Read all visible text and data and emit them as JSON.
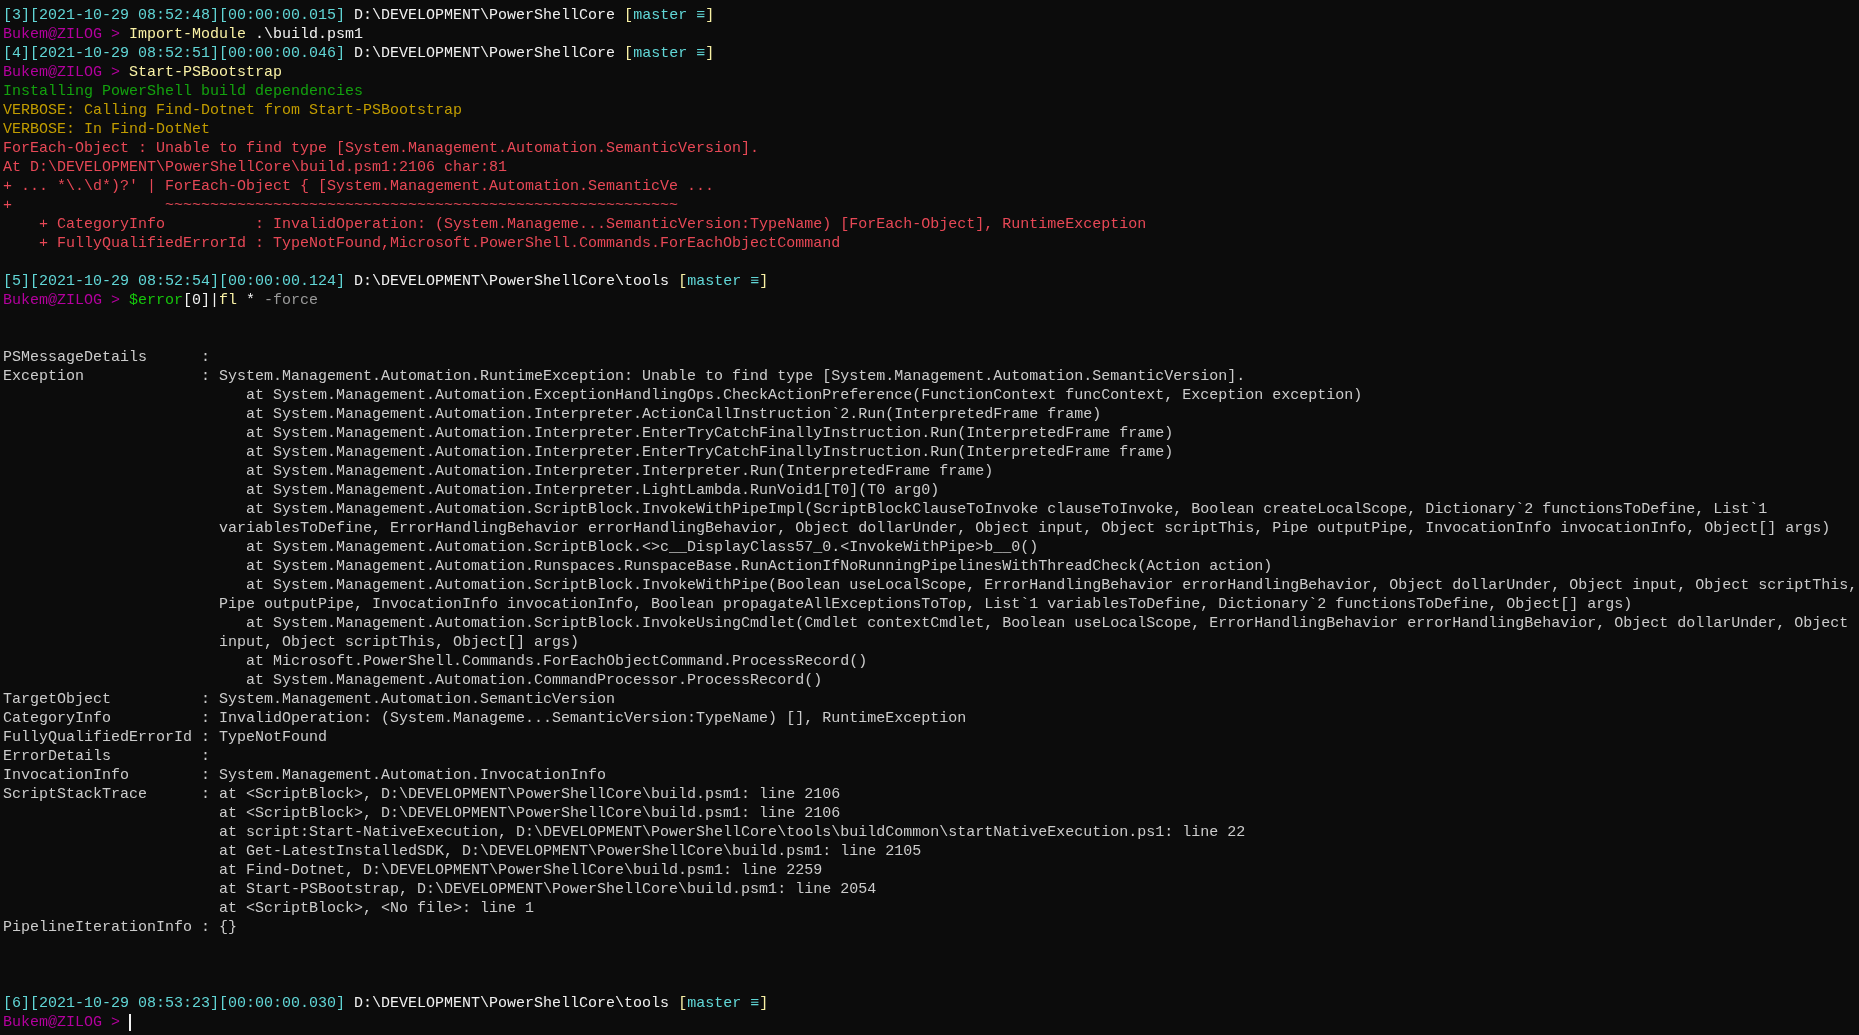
{
  "terminal": {
    "lines": [
      {
        "kind": "text",
        "segments": [
          {
            "kind": "history",
            "text": "[3][2021-10-29 08:52:48][00:00:00.015]"
          },
          {
            "kind": "path",
            "text": " D:\\DEVELOPMENT\\PowerShellCore "
          },
          {
            "kind": "bracket",
            "text": "["
          },
          {
            "kind": "branch",
            "text": "master ≡"
          },
          {
            "kind": "bracket",
            "text": "]"
          }
        ]
      },
      {
        "kind": "text",
        "segments": [
          {
            "kind": "user",
            "text": "Bukem@ZILOG > "
          },
          {
            "kind": "command",
            "text": "Import-Module"
          },
          {
            "kind": "argument",
            "text": " .\\build.psm1"
          }
        ]
      },
      {
        "kind": "text",
        "segments": [
          {
            "kind": "history",
            "text": "[4][2021-10-29 08:52:51][00:00:00.046]"
          },
          {
            "kind": "path",
            "text": " D:\\DEVELOPMENT\\PowerShellCore "
          },
          {
            "kind": "bracket",
            "text": "["
          },
          {
            "kind": "branch",
            "text": "master ≡"
          },
          {
            "kind": "bracket",
            "text": "]"
          }
        ]
      },
      {
        "kind": "text",
        "segments": [
          {
            "kind": "user",
            "text": "Bukem@ZILOG > "
          },
          {
            "kind": "command",
            "text": "Start-PSBootstrap"
          }
        ]
      },
      {
        "kind": "text",
        "segments": [
          {
            "kind": "success",
            "text": "Installing PowerShell build dependencies"
          }
        ]
      },
      {
        "kind": "text",
        "segments": [
          {
            "kind": "verbose",
            "text": "VERBOSE: Calling Find-Dotnet from Start-PSBootstrap"
          }
        ]
      },
      {
        "kind": "text",
        "segments": [
          {
            "kind": "verbose",
            "text": "VERBOSE: In Find-DotNet"
          }
        ]
      },
      {
        "kind": "text",
        "segments": [
          {
            "kind": "error",
            "text": "ForEach-Object : Unable to find type [System.Management.Automation.SemanticVersion]."
          }
        ]
      },
      {
        "kind": "text",
        "segments": [
          {
            "kind": "error",
            "text": "At D:\\DEVELOPMENT\\PowerShellCore\\build.psm1:2106 char:81"
          }
        ]
      },
      {
        "kind": "text",
        "segments": [
          {
            "kind": "error",
            "text": "+ ... *\\.\\d*)?' | ForEach-Object { [System.Management.Automation.SemanticVe ..."
          }
        ]
      },
      {
        "kind": "text",
        "segments": [
          {
            "kind": "error",
            "text": "+                 ~~~~~~~~~~~~~~~~~~~~~~~~~~~~~~~~~~~~~~~~~~~~~~~~~~~~~~~~~"
          }
        ]
      },
      {
        "kind": "text",
        "segments": [
          {
            "kind": "error",
            "text": "    + CategoryInfo          : InvalidOperation: (System.Manageme...SemanticVersion:TypeName) [ForEach-Object], RuntimeException"
          }
        ]
      },
      {
        "kind": "text",
        "segments": [
          {
            "kind": "error",
            "text": "    + FullyQualifiedErrorId : TypeNotFound,Microsoft.PowerShell.Commands.ForEachObjectCommand"
          }
        ]
      },
      {
        "kind": "blank"
      },
      {
        "kind": "text",
        "segments": [
          {
            "kind": "history",
            "text": "[5][2021-10-29 08:52:54][00:00:00.124]"
          },
          {
            "kind": "path",
            "text": " D:\\DEVELOPMENT\\PowerShellCore\\tools "
          },
          {
            "kind": "bracket",
            "text": "["
          },
          {
            "kind": "branch",
            "text": "master ≡"
          },
          {
            "kind": "bracket",
            "text": "]"
          }
        ]
      },
      {
        "kind": "text",
        "segments": [
          {
            "kind": "user",
            "text": "Bukem@ZILOG > "
          },
          {
            "kind": "variable",
            "text": "$error"
          },
          {
            "kind": "argument",
            "text": "[0]|"
          },
          {
            "kind": "command",
            "text": "fl"
          },
          {
            "kind": "argument",
            "text": " * "
          },
          {
            "kind": "parameter",
            "text": "-force"
          }
        ]
      },
      {
        "kind": "blank"
      },
      {
        "kind": "blank"
      },
      {
        "kind": "text",
        "segments": [
          {
            "kind": "output",
            "text": "PSMessageDetails      :"
          }
        ]
      },
      {
        "kind": "text",
        "segments": [
          {
            "kind": "output",
            "text": "Exception             : System.Management.Automation.RuntimeException: Unable to find type [System.Management.Automation.SemanticVersion]."
          }
        ]
      },
      {
        "kind": "text",
        "segments": [
          {
            "kind": "output",
            "text": "                           at System.Management.Automation.ExceptionHandlingOps.CheckActionPreference(FunctionContext funcContext, Exception exception)"
          }
        ]
      },
      {
        "kind": "text",
        "segments": [
          {
            "kind": "output",
            "text": "                           at System.Management.Automation.Interpreter.ActionCallInstruction`2.Run(InterpretedFrame frame)"
          }
        ]
      },
      {
        "kind": "text",
        "segments": [
          {
            "kind": "output",
            "text": "                           at System.Management.Automation.Interpreter.EnterTryCatchFinallyInstruction.Run(InterpretedFrame frame)"
          }
        ]
      },
      {
        "kind": "text",
        "segments": [
          {
            "kind": "output",
            "text": "                           at System.Management.Automation.Interpreter.EnterTryCatchFinallyInstruction.Run(InterpretedFrame frame)"
          }
        ]
      },
      {
        "kind": "text",
        "segments": [
          {
            "kind": "output",
            "text": "                           at System.Management.Automation.Interpreter.Interpreter.Run(InterpretedFrame frame)"
          }
        ]
      },
      {
        "kind": "text",
        "segments": [
          {
            "kind": "output",
            "text": "                           at System.Management.Automation.Interpreter.LightLambda.RunVoid1[T0](T0 arg0)"
          }
        ]
      },
      {
        "kind": "text",
        "segments": [
          {
            "kind": "output",
            "text": "                           at System.Management.Automation.ScriptBlock.InvokeWithPipeImpl(ScriptBlockClauseToInvoke clauseToInvoke, Boolean createLocalScope, Dictionary`2 functionsToDefine, List`1"
          }
        ]
      },
      {
        "kind": "text",
        "segments": [
          {
            "kind": "output",
            "text": "                        variablesToDefine, ErrorHandlingBehavior errorHandlingBehavior, Object dollarUnder, Object input, Object scriptThis, Pipe outputPipe, InvocationInfo invocationInfo, Object[] args)"
          }
        ]
      },
      {
        "kind": "text",
        "segments": [
          {
            "kind": "output",
            "text": "                           at System.Management.Automation.ScriptBlock.<>c__DisplayClass57_0.<InvokeWithPipe>b__0()"
          }
        ]
      },
      {
        "kind": "text",
        "segments": [
          {
            "kind": "output",
            "text": "                           at System.Management.Automation.Runspaces.RunspaceBase.RunActionIfNoRunningPipelinesWithThreadCheck(Action action)"
          }
        ]
      },
      {
        "kind": "text",
        "segments": [
          {
            "kind": "output",
            "text": "                           at System.Management.Automation.ScriptBlock.InvokeWithPipe(Boolean useLocalScope, ErrorHandlingBehavior errorHandlingBehavior, Object dollarUnder, Object input, Object scriptThis,"
          }
        ]
      },
      {
        "kind": "text",
        "segments": [
          {
            "kind": "output",
            "text": "                        Pipe outputPipe, InvocationInfo invocationInfo, Boolean propagateAllExceptionsToTop, List`1 variablesToDefine, Dictionary`2 functionsToDefine, Object[] args)"
          }
        ]
      },
      {
        "kind": "text",
        "segments": [
          {
            "kind": "output",
            "text": "                           at System.Management.Automation.ScriptBlock.InvokeUsingCmdlet(Cmdlet contextCmdlet, Boolean useLocalScope, ErrorHandlingBehavior errorHandlingBehavior, Object dollarUnder, Object"
          }
        ]
      },
      {
        "kind": "text",
        "segments": [
          {
            "kind": "output",
            "text": "                        input, Object scriptThis, Object[] args)"
          }
        ]
      },
      {
        "kind": "text",
        "segments": [
          {
            "kind": "output",
            "text": "                           at Microsoft.PowerShell.Commands.ForEachObjectCommand.ProcessRecord()"
          }
        ]
      },
      {
        "kind": "text",
        "segments": [
          {
            "kind": "output",
            "text": "                           at System.Management.Automation.CommandProcessor.ProcessRecord()"
          }
        ]
      },
      {
        "kind": "text",
        "segments": [
          {
            "kind": "output",
            "text": "TargetObject          : System.Management.Automation.SemanticVersion"
          }
        ]
      },
      {
        "kind": "text",
        "segments": [
          {
            "kind": "output",
            "text": "CategoryInfo          : InvalidOperation: (System.Manageme...SemanticVersion:TypeName) [], RuntimeException"
          }
        ]
      },
      {
        "kind": "text",
        "segments": [
          {
            "kind": "output",
            "text": "FullyQualifiedErrorId : TypeNotFound"
          }
        ]
      },
      {
        "kind": "text",
        "segments": [
          {
            "kind": "output",
            "text": "ErrorDetails          :"
          }
        ]
      },
      {
        "kind": "text",
        "segments": [
          {
            "kind": "output",
            "text": "InvocationInfo        : System.Management.Automation.InvocationInfo"
          }
        ]
      },
      {
        "kind": "text",
        "segments": [
          {
            "kind": "output",
            "text": "ScriptStackTrace      : at <ScriptBlock>, D:\\DEVELOPMENT\\PowerShellCore\\build.psm1: line 2106"
          }
        ]
      },
      {
        "kind": "text",
        "segments": [
          {
            "kind": "output",
            "text": "                        at <ScriptBlock>, D:\\DEVELOPMENT\\PowerShellCore\\build.psm1: line 2106"
          }
        ]
      },
      {
        "kind": "text",
        "segments": [
          {
            "kind": "output",
            "text": "                        at script:Start-NativeExecution, D:\\DEVELOPMENT\\PowerShellCore\\tools\\buildCommon\\startNativeExecution.ps1: line 22"
          }
        ]
      },
      {
        "kind": "text",
        "segments": [
          {
            "kind": "output",
            "text": "                        at Get-LatestInstalledSDK, D:\\DEVELOPMENT\\PowerShellCore\\build.psm1: line 2105"
          }
        ]
      },
      {
        "kind": "text",
        "segments": [
          {
            "kind": "output",
            "text": "                        at Find-Dotnet, D:\\DEVELOPMENT\\PowerShellCore\\build.psm1: line 2259"
          }
        ]
      },
      {
        "kind": "text",
        "segments": [
          {
            "kind": "output",
            "text": "                        at Start-PSBootstrap, D:\\DEVELOPMENT\\PowerShellCore\\build.psm1: line 2054"
          }
        ]
      },
      {
        "kind": "text",
        "segments": [
          {
            "kind": "output",
            "text": "                        at <ScriptBlock>, <No file>: line 1"
          }
        ]
      },
      {
        "kind": "text",
        "segments": [
          {
            "kind": "output",
            "text": "PipelineIterationInfo : {}"
          }
        ]
      },
      {
        "kind": "blank"
      },
      {
        "kind": "blank"
      },
      {
        "kind": "blank"
      },
      {
        "kind": "text",
        "segments": [
          {
            "kind": "history",
            "text": "[6][2021-10-29 08:53:23][00:00:00.030]"
          },
          {
            "kind": "path",
            "text": " D:\\DEVELOPMENT\\PowerShellCore\\tools "
          },
          {
            "kind": "bracket",
            "text": "["
          },
          {
            "kind": "branch",
            "text": "master ≡"
          },
          {
            "kind": "bracket",
            "text": "]"
          }
        ]
      },
      {
        "kind": "text",
        "cursor": true,
        "segments": [
          {
            "kind": "user",
            "text": "Bukem@ZILOG > "
          }
        ]
      }
    ]
  }
}
